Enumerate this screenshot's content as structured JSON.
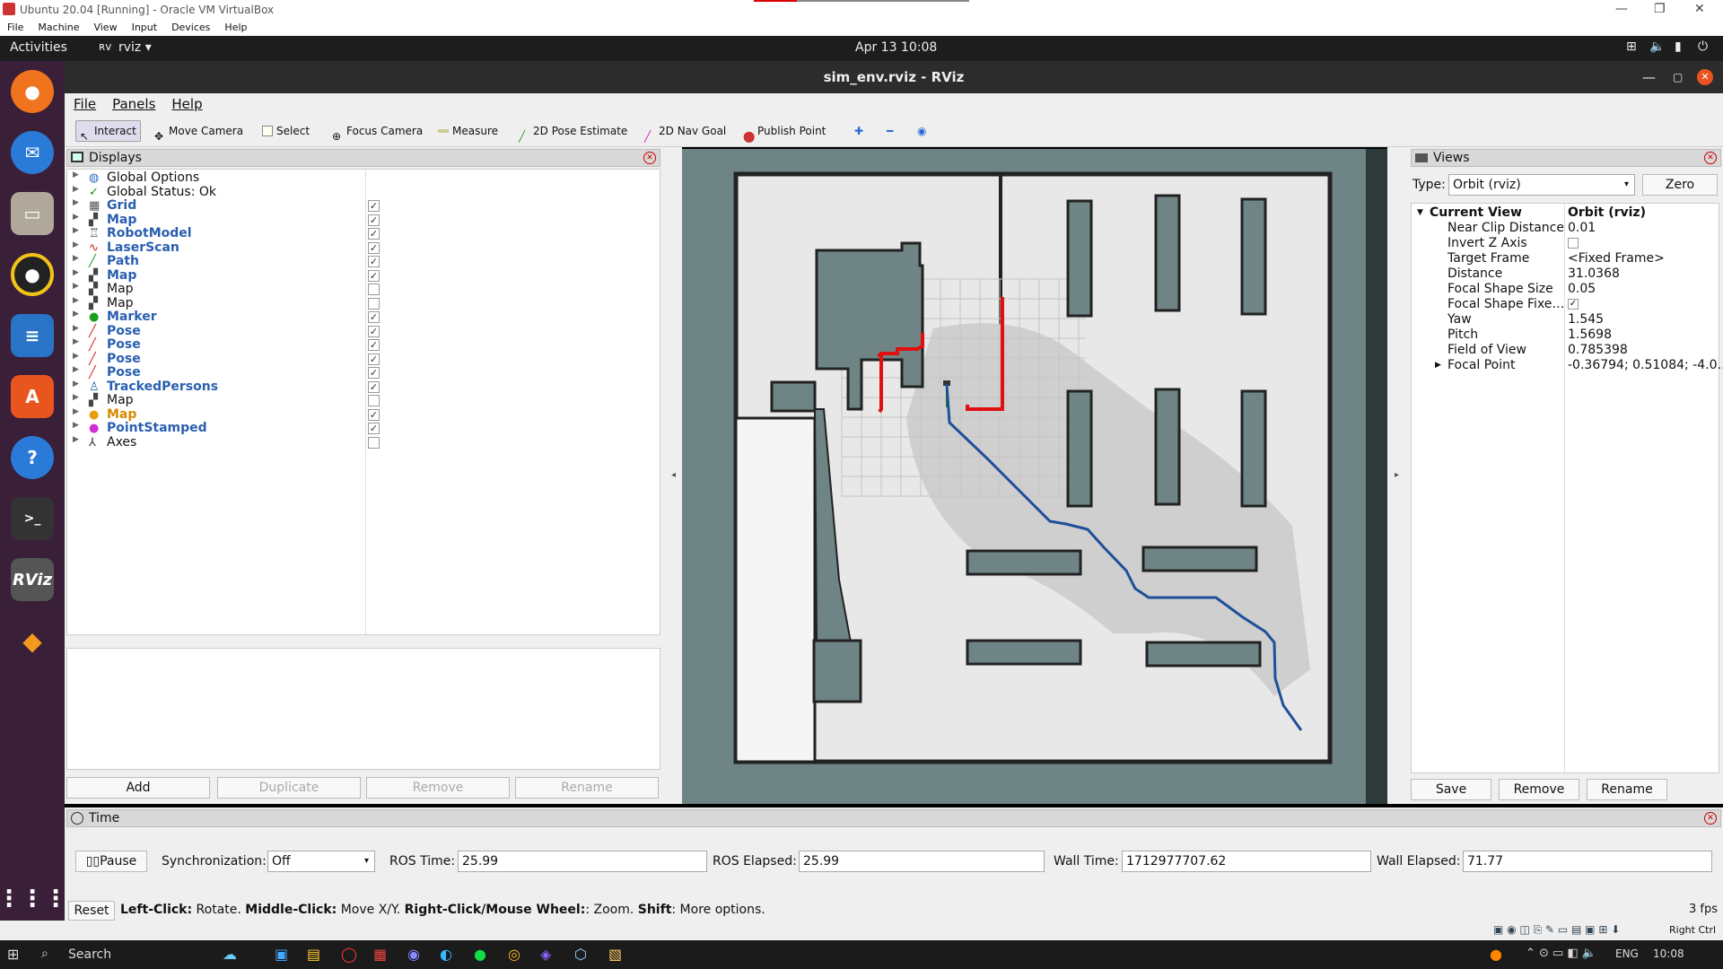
{
  "vbox": {
    "title": "Ubuntu 20.04 [Running] - Oracle VM VirtualBox",
    "menu": [
      "File",
      "Machine",
      "View",
      "Input",
      "Devices",
      "Help"
    ]
  },
  "ubuntu": {
    "activities": "Activities",
    "app_name": "rviz",
    "clock": "Apr 13  10:08",
    "dock_icons": [
      "firefox-icon",
      "thunderbird-icon",
      "files-icon",
      "rhythmbox-icon",
      "writer-icon",
      "software-icon",
      "help-icon",
      "terminal-icon",
      "rviz-icon",
      "sublime-icon",
      "apps-grid-icon"
    ],
    "rviz_dock_label": "RViz"
  },
  "rviz": {
    "window_title": "sim_env.rviz - RViz",
    "menu": [
      "File",
      "Panels",
      "Help"
    ],
    "toolbar": {
      "interact": "Interact",
      "move_camera": "Move Camera",
      "select": "Select",
      "focus_camera": "Focus Camera",
      "measure": "Measure",
      "pose_estimate": "2D Pose Estimate",
      "nav_goal": "2D Nav Goal",
      "publish_point": "Publish Point"
    },
    "displays": {
      "title": "Displays",
      "items": [
        {
          "label": "Global Options",
          "style": "plain",
          "icon": "globe-icon",
          "checked": null
        },
        {
          "label": "Global Status: Ok",
          "style": "plain",
          "icon": "check-icon",
          "checked": null
        },
        {
          "label": "Grid",
          "style": "blue",
          "icon": "grid-icon",
          "checked": true
        },
        {
          "label": "Map",
          "style": "blue",
          "icon": "map-icon",
          "checked": true
        },
        {
          "label": "RobotModel",
          "style": "blue",
          "icon": "robot-icon",
          "checked": true
        },
        {
          "label": "LaserScan",
          "style": "blue",
          "icon": "laser-icon",
          "checked": true
        },
        {
          "label": "Path",
          "style": "blue",
          "icon": "path-icon",
          "checked": true
        },
        {
          "label": "Map",
          "style": "blue",
          "icon": "map-icon",
          "checked": true
        },
        {
          "label": "Map",
          "style": "plain",
          "icon": "map-icon",
          "checked": false
        },
        {
          "label": "Map",
          "style": "plain",
          "icon": "map-icon",
          "checked": false
        },
        {
          "label": "Marker",
          "style": "blue",
          "icon": "marker-icon",
          "checked": true
        },
        {
          "label": "Pose",
          "style": "blue",
          "icon": "pose-icon",
          "checked": true
        },
        {
          "label": "Pose",
          "style": "blue",
          "icon": "pose-icon",
          "checked": true
        },
        {
          "label": "Pose",
          "style": "blue",
          "icon": "pose-icon",
          "checked": true
        },
        {
          "label": "Pose",
          "style": "blue",
          "icon": "pose-icon",
          "checked": true
        },
        {
          "label": "TrackedPersons",
          "style": "blue",
          "icon": "person-icon",
          "checked": true
        },
        {
          "label": "Map",
          "style": "plain",
          "icon": "map-icon",
          "checked": false
        },
        {
          "label": "Map",
          "style": "orange",
          "icon": "warning-icon",
          "checked": true
        },
        {
          "label": "PointStamped",
          "style": "blue",
          "icon": "point-icon",
          "checked": true
        },
        {
          "label": "Axes",
          "style": "plain",
          "icon": "axes-icon",
          "checked": false
        }
      ],
      "buttons": {
        "add": "Add",
        "duplicate": "Duplicate",
        "remove": "Remove",
        "rename": "Rename"
      }
    },
    "views": {
      "title": "Views",
      "type_label": "Type:",
      "type_value": "Orbit (rviz)",
      "zero": "Zero",
      "current_view_label": "Current View",
      "current_view_value": "Orbit (rviz)",
      "props": [
        {
          "k": "Near Clip Distance",
          "v": "0.01"
        },
        {
          "k": "Invert Z Axis",
          "v": "",
          "checkbox": false
        },
        {
          "k": "Target Frame",
          "v": "<Fixed Frame>"
        },
        {
          "k": "Distance",
          "v": "31.0368"
        },
        {
          "k": "Focal Shape Size",
          "v": "0.05"
        },
        {
          "k": "Focal Shape Fixe…",
          "v": "",
          "checkbox": true
        },
        {
          "k": "Yaw",
          "v": "1.545"
        },
        {
          "k": "Pitch",
          "v": "1.5698"
        },
        {
          "k": "Field of View",
          "v": "0.785398"
        },
        {
          "k": "Focal Point",
          "v": "-0.36794; 0.51084; -4.0…"
        }
      ],
      "buttons": {
        "save": "Save",
        "remove": "Remove",
        "rename": "Rename"
      }
    },
    "time": {
      "title": "Time",
      "pause": "Pause",
      "sync_label": "Synchronization:",
      "sync_value": "Off",
      "ros_time_label": "ROS Time:",
      "ros_time": "25.99",
      "ros_elapsed_label": "ROS Elapsed:",
      "ros_elapsed": "25.99",
      "wall_time_label": "Wall Time:",
      "wall_time": "1712977707.62",
      "wall_elapsed_label": "Wall Elapsed:",
      "wall_elapsed": "71.77"
    },
    "status": {
      "reset": "Reset",
      "k1": "Left-Click:",
      "v1": " Rotate. ",
      "k2": "Middle-Click:",
      "v2": " Move X/Y. ",
      "k3": "Right-Click/Mouse Wheel:",
      "v3": ": Zoom. ",
      "k4": "Shift",
      "v4": ": More options.",
      "fps": "3 fps"
    }
  },
  "host": {
    "right_ctrl": "Right Ctrl",
    "search": "Search",
    "lang": "ENG",
    "clock": "10:08"
  },
  "colors": {
    "path_blue": "#1f4f9a",
    "laser_red": "#e01010",
    "map_bg": "#6f8585"
  }
}
